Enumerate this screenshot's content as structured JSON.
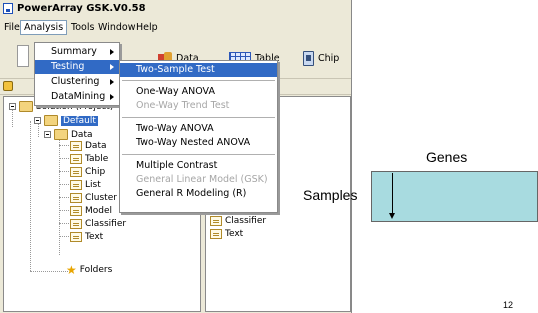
{
  "window": {
    "title": "PowerArray GSK.V0.58"
  },
  "menubar": [
    "File",
    "Analysis",
    "Tools",
    "Window",
    "Help"
  ],
  "toolbar": {
    "data_label": "Data",
    "table_label": "Table",
    "chip_label": "Chip"
  },
  "tree": {
    "root_label": "Solution (Project)",
    "default_label": "Default",
    "data_label": "Data",
    "children": [
      "Data",
      "Table",
      "Chip",
      "List",
      "Cluster",
      "Model",
      "Classifier",
      "Text"
    ],
    "folders_label": "Folders"
  },
  "right_pane": {
    "items": [
      "Classifier",
      "Text"
    ]
  },
  "analysis_menu": {
    "items": [
      "Summary",
      "Testing",
      "Clustering",
      "DataMining"
    ],
    "highlighted": "Testing"
  },
  "testing_menu": {
    "items": [
      {
        "label": "Two-Sample Test",
        "highlighted": true,
        "enabled": true
      },
      {
        "label": "One-Way ANOVA",
        "enabled": true
      },
      {
        "label": "One-Way Trend Test",
        "enabled": false
      },
      {
        "label": "Two-Way ANOVA",
        "enabled": true
      },
      {
        "label": "Two-Way Nested ANOVA",
        "enabled": true
      },
      {
        "label": "Multiple Contrast",
        "enabled": true
      },
      {
        "label": "General Linear Model (GSK)",
        "enabled": false
      },
      {
        "label": "General R Modeling (R)",
        "enabled": true
      }
    ]
  },
  "diagram": {
    "genes_label": "Genes",
    "samples_label": "Samples",
    "fill_color": "#a8dbe0"
  },
  "page_number": "12",
  "colors": {
    "highlight": "#316ac5",
    "chrome": "#ece9d8"
  }
}
